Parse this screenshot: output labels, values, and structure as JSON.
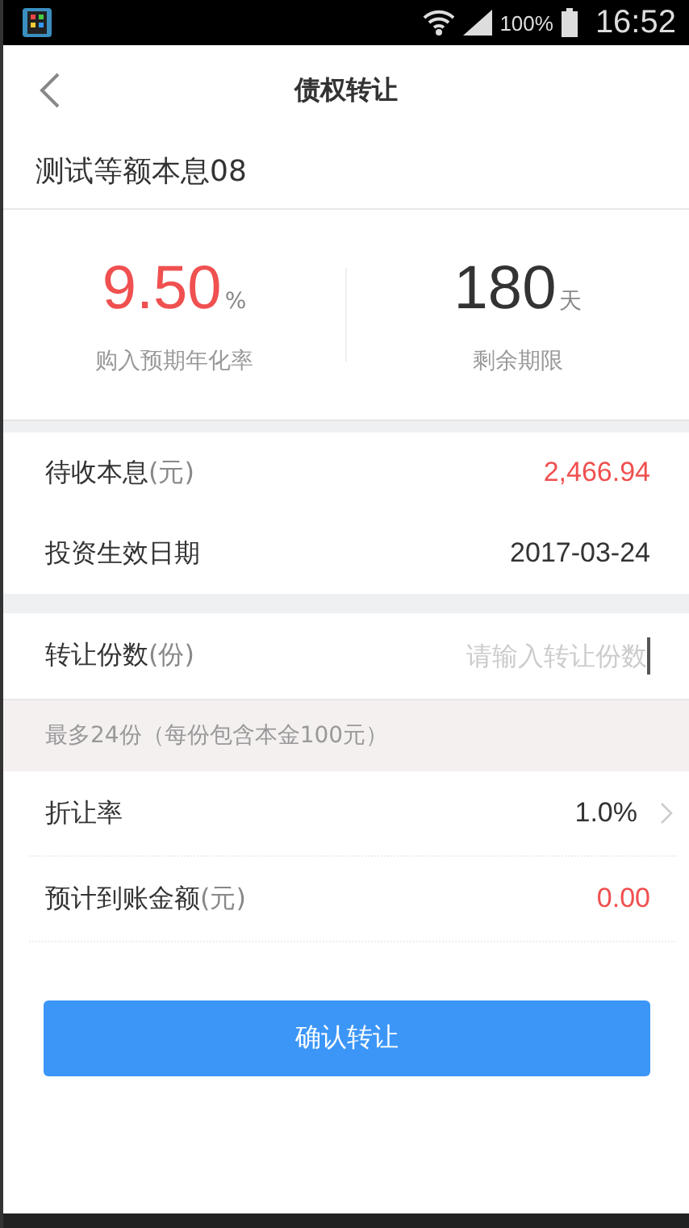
{
  "status_bar": {
    "battery": "100%",
    "time": "16:52"
  },
  "header": {
    "title": "债权转让"
  },
  "product": {
    "name": "测试等额本息08"
  },
  "stats": [
    {
      "value": "9.50",
      "unit": "%",
      "label": "购入预期年化率",
      "highlight": true
    },
    {
      "value": "180",
      "unit": "天",
      "label": "剩余期限",
      "highlight": false
    }
  ],
  "info_rows": [
    {
      "label": "待收本息",
      "unit": "(元)",
      "value": "2,466.94",
      "highlight": true
    },
    {
      "label": "投资生效日期",
      "value": "2017-03-24",
      "highlight": false
    }
  ],
  "transfer": {
    "label": "转让份数",
    "unit": "(份)",
    "placeholder": "请输入转让份数",
    "hint": "最多24份（每份包含本金100元）"
  },
  "rows": [
    {
      "kind": "select",
      "label": "折让率",
      "value": "1.0%",
      "highlight": false
    },
    {
      "kind": "value",
      "label": "预计到账金额",
      "unit": "(元)",
      "value": "0.00",
      "highlight": true
    }
  ],
  "confirm_button": "确认转让"
}
